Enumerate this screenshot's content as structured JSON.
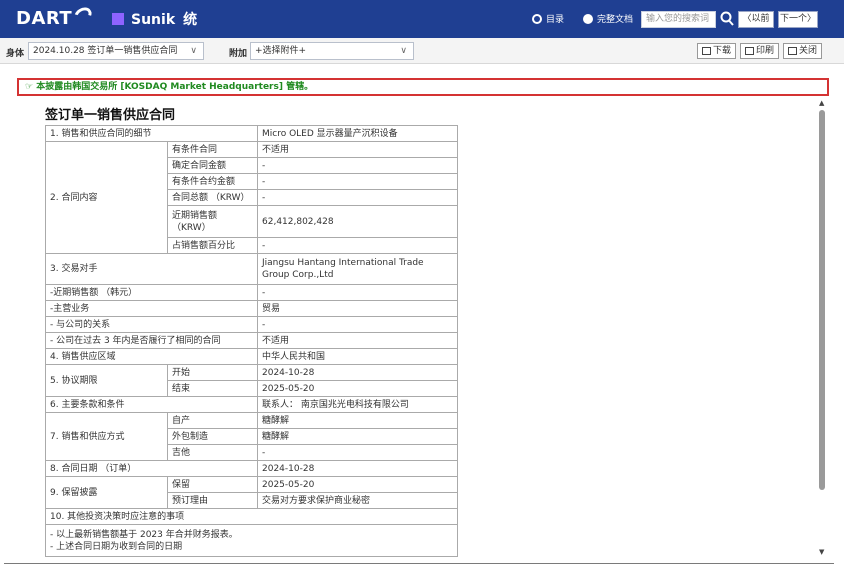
{
  "header": {
    "logo_text": "DART",
    "company_name": "Sunik",
    "company_extra": "统",
    "radio_toc": "目录",
    "radio_full": "完整文档",
    "search_placeholder": "输入您的搜索词",
    "prev_label": "〈以前",
    "next_label": "下一个〉",
    "company_square_color": "#8e63ff",
    "bar_color": "#1f3f92"
  },
  "toolbar": {
    "body_label": "身体",
    "body_select": "2024.10.28 签订单一销售供应合同",
    "attach_label": "附加",
    "attach_select": "+选择附件+",
    "download_label": "下载",
    "print_label": "印刷",
    "close_label": "关闭"
  },
  "notice": {
    "text": "本披露由韩国交易所 [KOSDAQ Market Headquarters] 管辖。",
    "border_color": "#d43333",
    "text_color": "#208a20"
  },
  "document": {
    "title": "签订单一销售供应合同",
    "rows": {
      "r1_label": "1. 销售和供应合同的细节",
      "r1_value": "Micro OLED 显示器量产沉积设备",
      "r2_label": "2. 合同内容",
      "r2_sub1": "有条件合同",
      "r2_val1": "不适用",
      "r2_sub2": "确定合同金额",
      "r2_val2": "-",
      "r2_sub3": "有条件合约金额",
      "r2_val3": "-",
      "r2_sub4": "合同总额 （KRW）",
      "r2_val4": "-",
      "r2_sub5": "近期销售额 （KRW）",
      "r2_val5": "62,412,802,428",
      "r2_sub6": "占销售额百分比",
      "r2_val6": "-",
      "r3_label": "3. 交易对手",
      "r3_value": "Jiangsu Hantang International Trade Group Corp.,Ltd",
      "r3a_label": "-近期销售额 （韩元）",
      "r3a_value": "-",
      "r3b_label": "-主营业务",
      "r3b_value": "贸易",
      "r3c_label": "- 与公司的关系",
      "r3c_value": "-",
      "r3d_label": "- 公司在过去 3 年内是否履行了相同的合同",
      "r3d_value": "不适用",
      "r4_label": "4. 销售供应区域",
      "r4_value": "中华人民共和国",
      "r5_label": "5. 协议期限",
      "r5_sub1": "开始",
      "r5_val1": "2024-10-28",
      "r5_sub2": "结束",
      "r5_val2": "2025-05-20",
      "r6_label": "6. 主要条款和条件",
      "r6_value": "联系人： 南京国兆光电科技有限公司",
      "r7_label": "7. 销售和供应方式",
      "r7_sub1": "自产",
      "r7_val1": "糖酵解",
      "r7_sub2": "外包制造",
      "r7_val2": "糖酵解",
      "r7_sub3": "吉他",
      "r7_val3": "-",
      "r8_label": "8. 合同日期 （订单）",
      "r8_value": "2024-10-28",
      "r9_label": "9. 保留披露",
      "r9_sub1": "保留",
      "r9_val1": "2025-05-20",
      "r9_sub2": "预订理由",
      "r9_val2": "交易对方要求保护商业秘密",
      "r10_label": "10. 其他投资决策时应注意的事项",
      "r10_line1": "- 以上最新销售额基于 2023 年合并财务报表。",
      "r10_line2": "- 上述合同日期为收到合同的日期"
    }
  }
}
